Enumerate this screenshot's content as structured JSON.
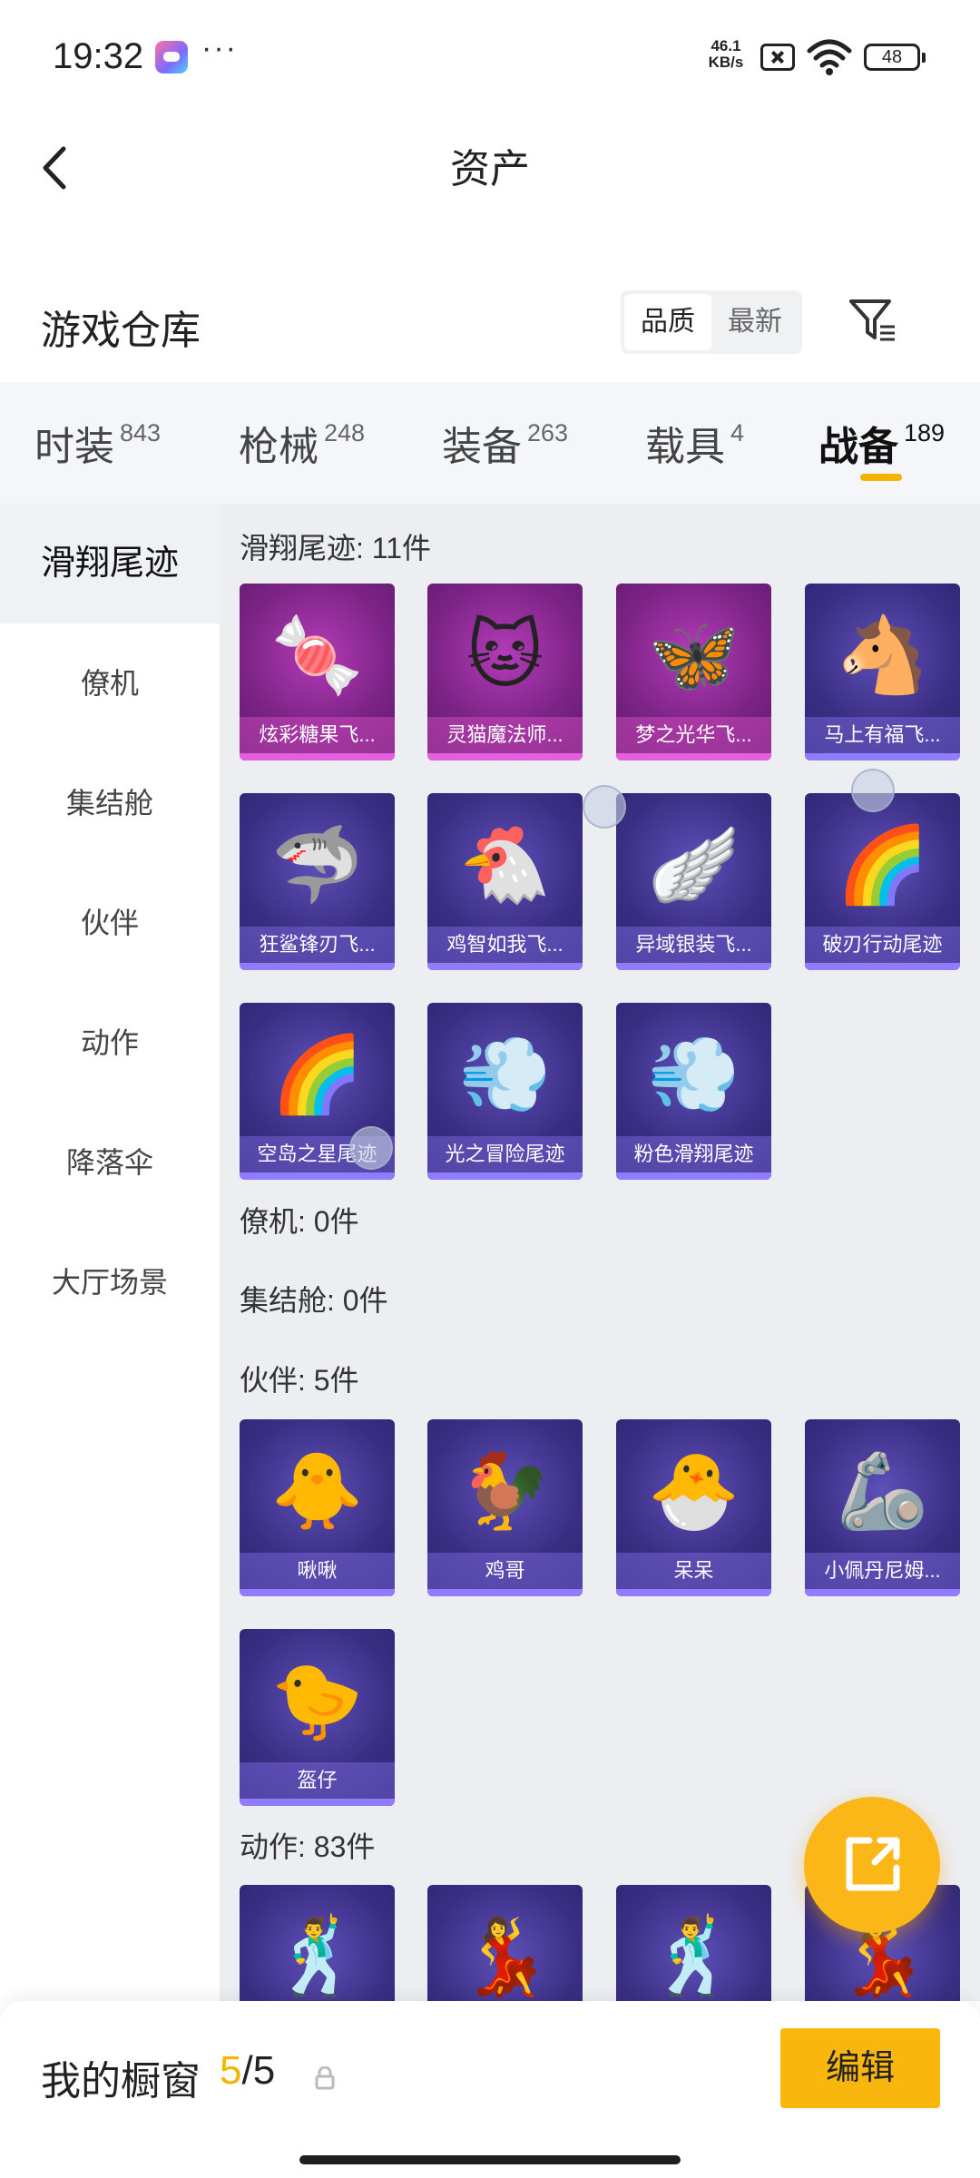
{
  "status": {
    "time": "19:32",
    "more": "···",
    "net_speed": "46.1\nKB/s",
    "battery": "48"
  },
  "header": {
    "title": "资产"
  },
  "warehouse": {
    "title": "游戏仓库",
    "sort": [
      "品质",
      "最新"
    ],
    "sort_active": 0
  },
  "tabs": [
    {
      "label": "时装",
      "count": "843"
    },
    {
      "label": "枪械",
      "count": "248"
    },
    {
      "label": "装备",
      "count": "263"
    },
    {
      "label": "载具",
      "count": "4"
    },
    {
      "label": "战备",
      "count": "189"
    }
  ],
  "active_tab": 4,
  "sidebar": [
    "滑翔尾迹",
    "僚机",
    "集结舱",
    "伙伴",
    "动作",
    "降落伞",
    "大厅场景"
  ],
  "active_sidebar": 0,
  "sections": {
    "glide": {
      "title": "滑翔尾迹: 11件",
      "items": [
        {
          "name": "炫彩糖果飞...",
          "icon": "candy-wings-icon",
          "glyph": "🍬"
        },
        {
          "name": "灵猫魔法师...",
          "icon": "magic-cat-icon",
          "glyph": "🐱"
        },
        {
          "name": "梦之光华飞...",
          "icon": "dream-light-wings-icon",
          "glyph": "🦋"
        },
        {
          "name": "马上有福飞...",
          "icon": "lucky-horse-icon",
          "glyph": "🐴"
        },
        {
          "name": "狂鲨锋刃飞...",
          "icon": "shark-blade-icon",
          "glyph": "🦈"
        },
        {
          "name": "鸡智如我飞...",
          "icon": "smart-chicken-icon",
          "glyph": "🐔"
        },
        {
          "name": "异域银装飞...",
          "icon": "silver-wings-icon",
          "glyph": "🪽"
        },
        {
          "name": "破刃行动尾迹",
          "icon": "blade-trail-icon",
          "glyph": "🌈"
        },
        {
          "name": "空岛之星尾迹",
          "icon": "sky-island-star-icon",
          "glyph": "🌈"
        },
        {
          "name": "光之冒险尾迹",
          "icon": "light-adventure-icon",
          "glyph": "💨"
        },
        {
          "name": "粉色滑翔尾迹",
          "icon": "pink-glide-icon",
          "glyph": "💨"
        }
      ]
    },
    "wingman": {
      "title": "僚机: 0件"
    },
    "capsule": {
      "title": "集结舱: 0件"
    },
    "partner": {
      "title": "伙伴: 5件",
      "items": [
        {
          "name": "啾啾",
          "icon": "pink-bird-icon",
          "glyph": "🐥"
        },
        {
          "name": "鸡哥",
          "icon": "chicken-bro-icon",
          "glyph": "🐓"
        },
        {
          "name": "呆呆",
          "icon": "egg-chick-icon",
          "glyph": "🐣"
        },
        {
          "name": "小佩丹尼姆...",
          "icon": "armored-figure-icon",
          "glyph": "🦾"
        },
        {
          "name": "盔仔",
          "icon": "helmet-chick-icon",
          "glyph": "🐤"
        }
      ]
    },
    "emote": {
      "title": "动作: 83件",
      "items": [
        {
          "name": "",
          "icon": "dance-silhouette-icon",
          "glyph": "🕺"
        },
        {
          "name": "",
          "icon": "fire-dance-icon",
          "glyph": "💃"
        },
        {
          "name": "",
          "icon": "glow-dance-icon",
          "glyph": "🕺"
        },
        {
          "name": "",
          "icon": "music-dance-icon",
          "glyph": "💃"
        }
      ]
    }
  },
  "showcase": {
    "label": "我的橱窗",
    "current": "5",
    "total": "/5",
    "edit": "编辑"
  }
}
